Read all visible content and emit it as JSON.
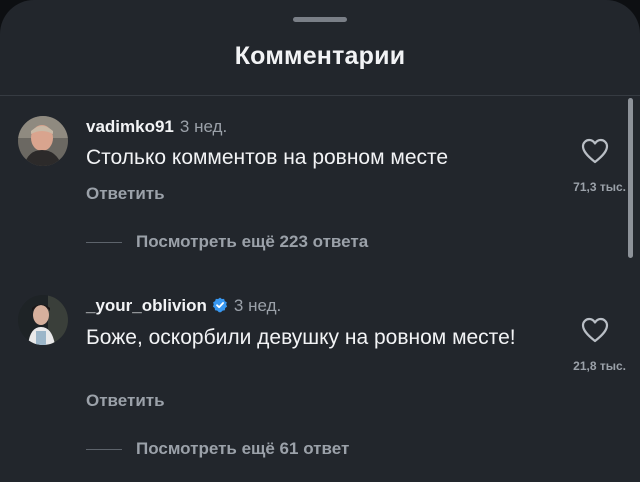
{
  "header": {
    "title": "Комментарии"
  },
  "comments": [
    {
      "username": "vadimko91",
      "time": "3 нед.",
      "text": "Столько комментов на ровном месте",
      "reply_label": "Ответить",
      "likes": "71,3 тыс.",
      "more_replies": "Посмотреть ещё 223 ответа",
      "verified": false
    },
    {
      "username": "_your_oblivion",
      "time": "3 нед.",
      "text": "Боже, оскорбили девушку на ровном месте!",
      "reply_label": "Ответить",
      "likes": "21,8 тыс.",
      "more_replies": "Посмотреть ещё 61 ответ",
      "verified": true
    }
  ],
  "colors": {
    "background": "#22262c",
    "text_primary": "#f2f3f5",
    "text_secondary": "#9ba1a9",
    "verified": "#3897f0"
  }
}
